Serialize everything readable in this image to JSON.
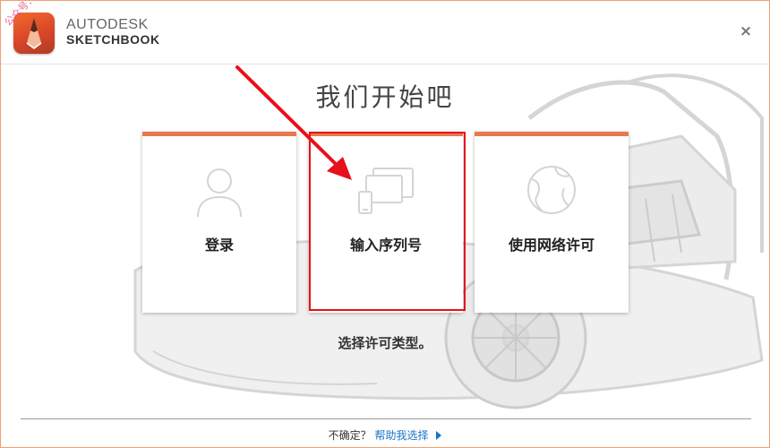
{
  "header": {
    "brand_line1": "AUTODESK",
    "brand_line2": "SKETCHBOOK",
    "close_label": "×",
    "watermark": "公众号：软件安装管家"
  },
  "main": {
    "title": "我们开始吧",
    "cards": [
      {
        "label": "登录",
        "icon": "user-icon"
      },
      {
        "label": "输入序列号",
        "icon": "devices-icon"
      },
      {
        "label": "使用网络许可",
        "icon": "network-globe-icon"
      }
    ],
    "subtitle": "选择许可类型。"
  },
  "footer": {
    "question": "不确定？",
    "help_link": "帮助我选择"
  },
  "colors": {
    "accent": "#e57a4e",
    "highlight": "#e8101a",
    "link": "#1a73c8"
  }
}
